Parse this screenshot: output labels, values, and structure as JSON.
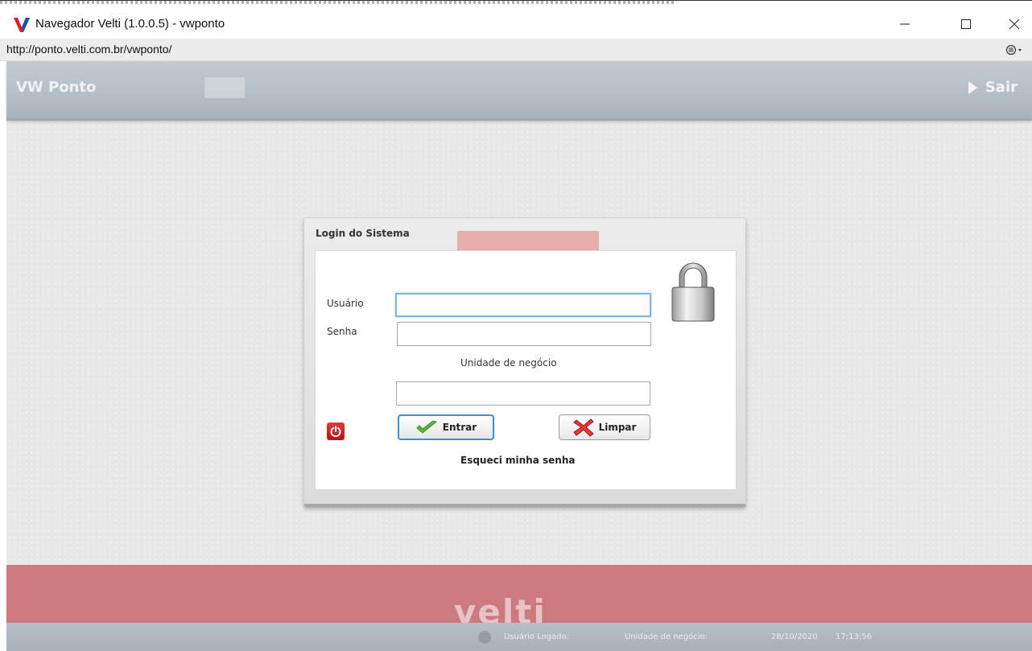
{
  "window": {
    "title": "Navegador Velti (1.0.0.5) - vwponto",
    "controls": [
      "minimize-icon",
      "maximize-icon",
      "close-icon"
    ]
  },
  "address_bar": {
    "url": "http://ponto.velti.com.br/vwponto/",
    "menu_icon": "menu-icon"
  },
  "header": {
    "title": "VW Ponto",
    "logout_label": "Sair"
  },
  "login": {
    "title": "Login do Sistema",
    "user_label": "Usuário",
    "user_value": "",
    "password_label": "Senha",
    "password_value": "",
    "unit_label": "Unidade de negócio",
    "unit_value": "",
    "enter_label": "Entrar",
    "clear_label": "Limpar",
    "forgot_label": "Esqueci minha senha",
    "icons": [
      "lock-icon",
      "power-icon",
      "checkmark-icon",
      "x-icon"
    ]
  },
  "footer": {
    "logo_text": "velti",
    "user_logged_label": "Usuário Logado:",
    "unit_label": "Unidade de negócio:",
    "date": "28/10/2020",
    "time": "17:13:56"
  },
  "colors": {
    "header": "#b5bec5",
    "footer_band": "#cc7a80",
    "focus_border": "#7eb4ea",
    "entrar_border": "#3d8fd8",
    "power_red": "#d32626"
  }
}
